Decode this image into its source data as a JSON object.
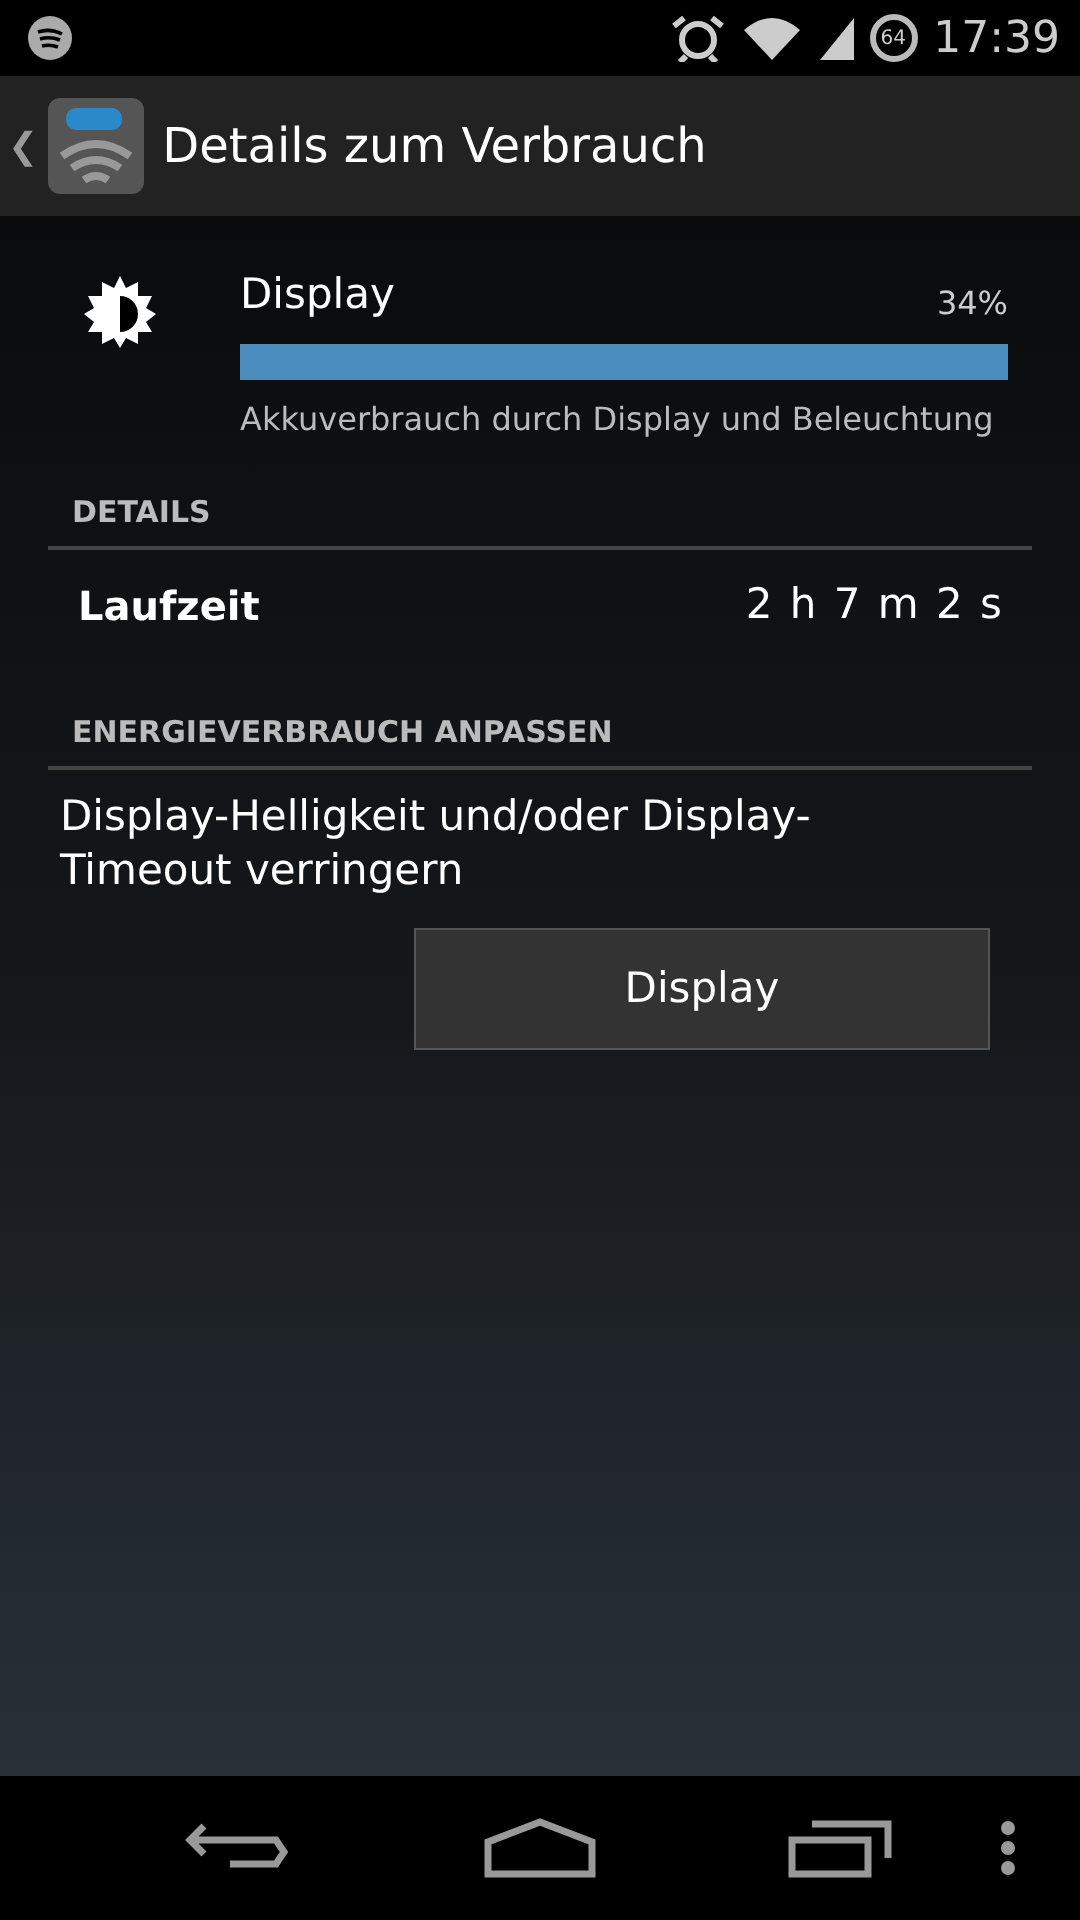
{
  "status_bar": {
    "battery": "64",
    "time": "17:39"
  },
  "action_bar": {
    "back": "❮",
    "title": "Details zum Verbrauch"
  },
  "usage": {
    "name": "Display",
    "percent": "34%",
    "level": 1.0,
    "description": "Akkuverbrauch durch Display und Beleuchtung"
  },
  "sections": [
    {
      "header": "DETAILS",
      "rows": [
        {
          "kind": "stat",
          "label": "Laufzeit",
          "value": "2 h 7 m 2 s"
        }
      ]
    },
    {
      "header": "ENERGIEVERBRAUCH ANPASSEN",
      "rows": [
        {
          "kind": "action",
          "text": "Display-Helligkeit und/oder Display-Timeout verringern",
          "button": "Display"
        }
      ]
    }
  ]
}
